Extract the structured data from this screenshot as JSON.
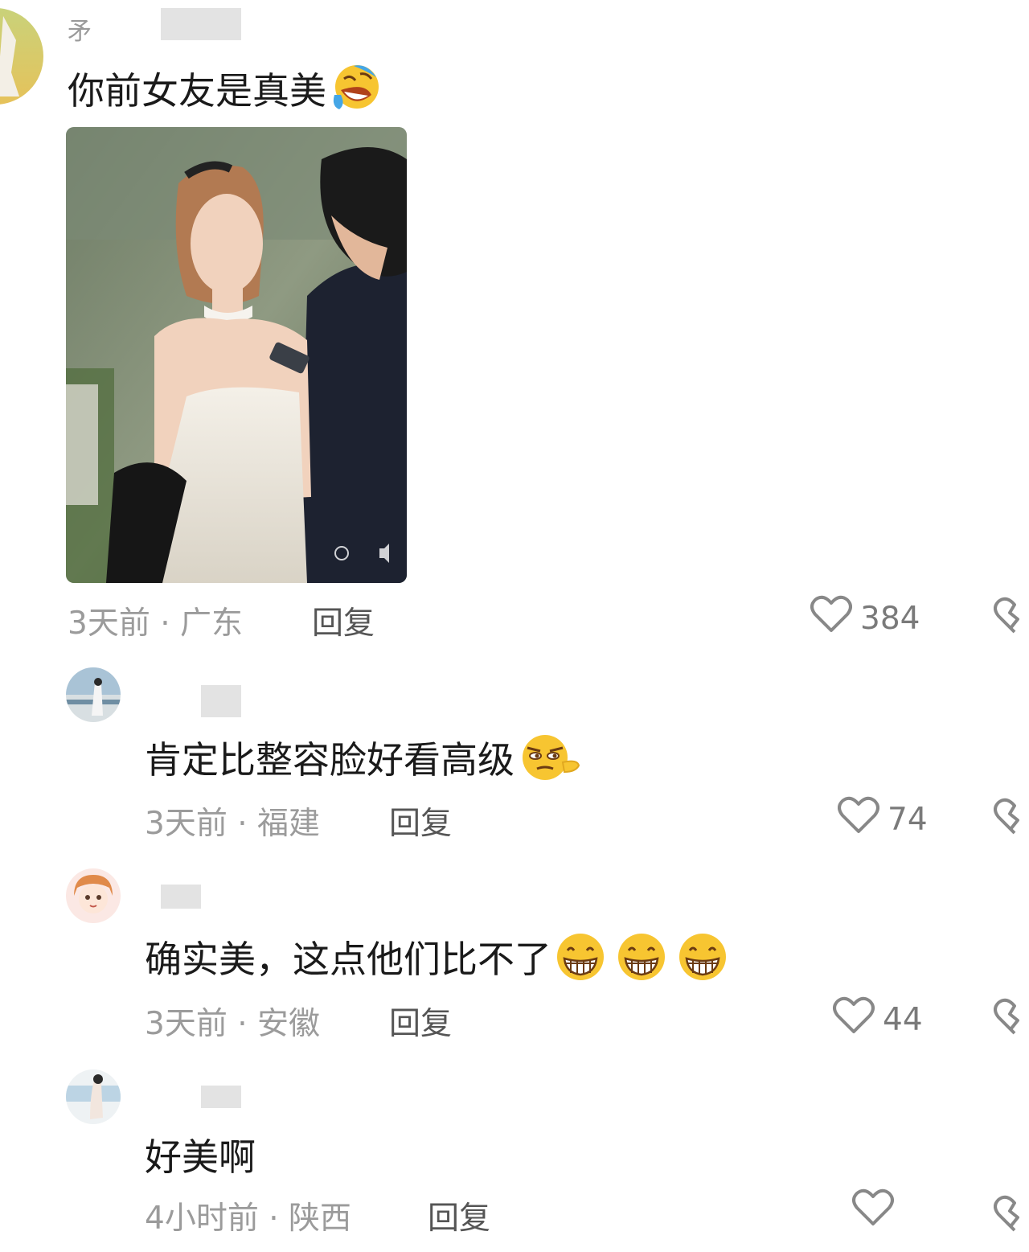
{
  "comments": [
    {
      "username": "矛",
      "text": "你前女友是真美",
      "emojis": [
        "laugh-cry-emoji"
      ],
      "meta": "3天前 · 广东",
      "reply_label": "回复",
      "likes": "384",
      "attached_image": true
    },
    {
      "username": "",
      "text": "肯定比整容脸好看高级",
      "emojis": [
        "smirk-emoji"
      ],
      "meta": "3天前 · 福建",
      "reply_label": "回复",
      "likes": "74"
    },
    {
      "username": "",
      "text": "确实美，这点他们比不了",
      "emojis": [
        "grin-emoji",
        "grin-emoji",
        "grin-emoji"
      ],
      "meta": "3天前 · 安徽",
      "reply_label": "回复",
      "likes": "44"
    },
    {
      "username": "",
      "text": "好美啊",
      "emojis": [],
      "meta": "4小时前 · 陕西",
      "reply_label": "回复",
      "likes": ""
    }
  ],
  "colors": {
    "meta_gray": "#9b9b9b",
    "text": "#1a1a1a",
    "mask": "#e3e3e3"
  }
}
